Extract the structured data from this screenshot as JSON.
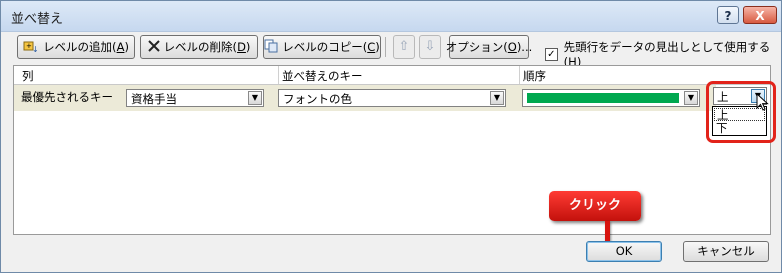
{
  "window": {
    "title": "並べ替え",
    "help_label": "?",
    "close_label": "X"
  },
  "toolbar": {
    "add_level": {
      "label": "レベルの追加(",
      "key": "A",
      "end": ")"
    },
    "delete_level": {
      "label": "レベルの削除(",
      "key": "D",
      "end": ")"
    },
    "copy_level": {
      "label": "レベルのコピー(",
      "key": "C",
      "end": ")"
    },
    "up_arrow": "⇧",
    "down_arrow": "⇩",
    "options": {
      "label": "オプション(",
      "key": "O",
      "end": ")..."
    },
    "header_checkbox": {
      "label": "先頭行をデータの見出しとして使用する(",
      "key": "H",
      "end": ")",
      "checked": true,
      "check_glyph": "✓"
    }
  },
  "grid": {
    "headers": {
      "column": "列",
      "sort_key": "並べ替えのキー",
      "order": "順序"
    },
    "row": {
      "label": "最優先されるキー",
      "column_value": "資格手当",
      "sort_key_value": "フォントの色",
      "order_color": "#00a84f",
      "position_value": "上"
    }
  },
  "dropdown": {
    "options": [
      "上",
      "下"
    ],
    "selected": "上"
  },
  "callout": {
    "text": "クリック"
  },
  "footer": {
    "ok_label": "OK",
    "cancel_label": "キャンセル"
  },
  "icons": {
    "add": "add-level-icon",
    "delete": "delete-level-icon",
    "copy": "copy-level-icon",
    "dropdown": "chevron-down-icon",
    "cursor": "mouse-cursor-icon"
  },
  "colors": {
    "highlight": "#e2231a",
    "callout": "#d8140f",
    "swatch": "#00a84f"
  }
}
